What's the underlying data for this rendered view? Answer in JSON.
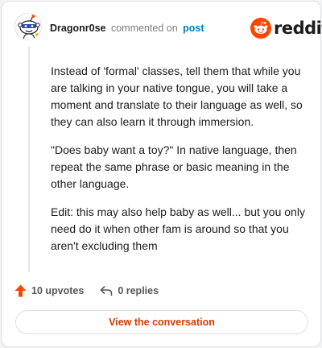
{
  "comment": {
    "username": "Dragonr0se",
    "action_text": "commented on",
    "post_link": "post",
    "paragraphs": [
      "Instead of 'formal' classes, tell them that while you are talking in your native tongue, you will take a moment and translate to their language as well, so they can also learn it through immersion.",
      "\"Does baby want a toy?\" In native language, then repeat the same phrase or basic meaning in the other language.",
      "Edit: this may also help baby as well... but you only need do it when other fam is around so that you aren't excluding them"
    ]
  },
  "brand": {
    "wordmark": "reddit",
    "color": "#ff4500"
  },
  "stats": {
    "upvotes": "10 upvotes",
    "replies": "0 replies"
  },
  "cta": {
    "label": "View the conversation",
    "color": "#d93a00"
  },
  "icons": {
    "avatar": "snoo-avatar-icon",
    "logo": "reddit-alien-icon",
    "upvote": "upvote-arrow-icon",
    "reply": "reply-arrow-icon"
  }
}
